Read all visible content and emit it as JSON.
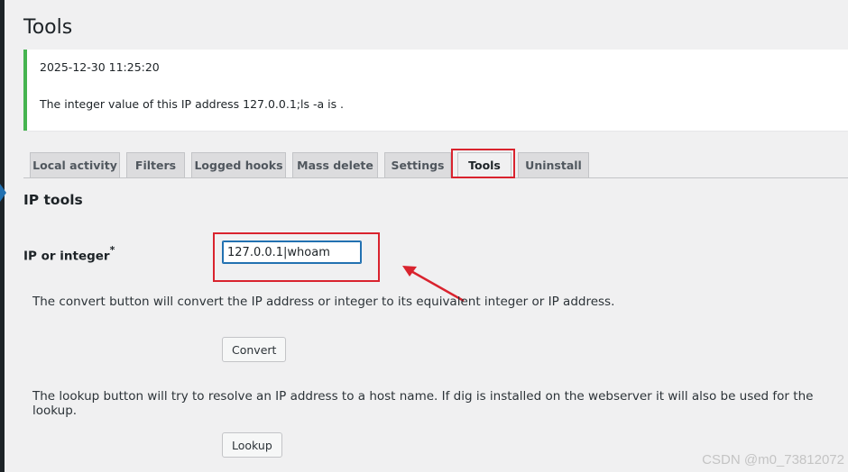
{
  "page": {
    "title": "Tools"
  },
  "notice": {
    "timestamp": "2025-12-30 11:25:20",
    "message": "The integer value of this IP address 127.0.0.1;ls -a is ."
  },
  "tabs": [
    {
      "label": "Local activity"
    },
    {
      "label": "Filters"
    },
    {
      "label": "Logged hooks"
    },
    {
      "label": "Mass delete"
    },
    {
      "label": "Settings"
    },
    {
      "label": "Tools",
      "active": true
    },
    {
      "label": "Uninstall"
    }
  ],
  "section": {
    "heading": "IP tools",
    "field_label": "IP or integer",
    "required_mark": "*",
    "field_value": "127.0.0.1|whoam",
    "convert_desc": "The convert button will convert the IP address or integer to its equivalent integer or IP address.",
    "convert_label": "Convert",
    "lookup_desc": "The lookup button will try to resolve an IP address to a host name. If dig is installed on the webserver it will also be used for the lookup.",
    "lookup_label": "Lookup"
  },
  "watermark": "CSDN @m0_73812072",
  "colors": {
    "annotation": "#d9232e",
    "notice_border": "#46b450",
    "accent": "#2271b1"
  }
}
